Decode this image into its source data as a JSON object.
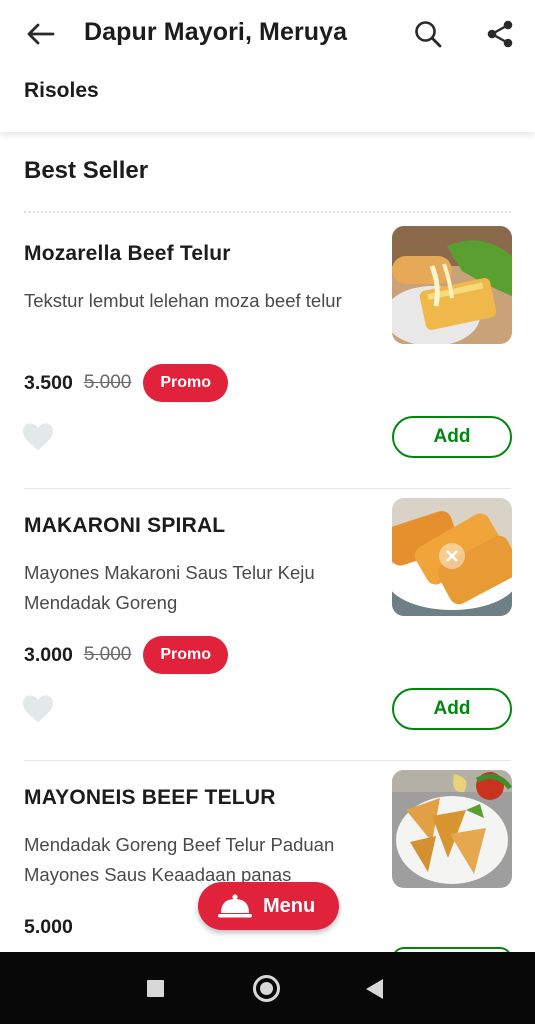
{
  "header": {
    "title": "Dapur Mayori, Meruya",
    "back_icon": "arrow-left-icon",
    "search_icon": "search-icon",
    "share_icon": "share-icon",
    "category_tab": "Risoles"
  },
  "section": {
    "title": "Best Seller"
  },
  "items": [
    {
      "name": "Mozarella Beef Telur",
      "description": "Tekstur lembut lelehan moza beef telur",
      "price": "3.500",
      "old_price": "5.000",
      "badge": "Promo",
      "add_label": "Add",
      "favorite_icon": "heart-icon"
    },
    {
      "name": "MAKARONI SPIRAL",
      "description": "Mayones Makaroni Saus Telur Keju Mendadak Goreng",
      "price": "3.000",
      "old_price": "5.000",
      "badge": "Promo",
      "add_label": "Add",
      "favorite_icon": "heart-icon"
    },
    {
      "name": "MAYONEIS BEEF TELUR",
      "description": "Mendadak Goreng Beef Telur Paduan Mayones Saus Keaadaan panas",
      "price": "5.000"
    }
  ],
  "menu_button": {
    "label": "Menu",
    "icon": "cloche-icon"
  },
  "colors": {
    "accent_red": "#e0223b",
    "add_green": "#00880d",
    "text_dark": "#1c1c1c"
  },
  "navigation_bar": {
    "recents_icon": "square-icon",
    "home_icon": "circle-icon",
    "back_icon": "triangle-back-icon"
  }
}
